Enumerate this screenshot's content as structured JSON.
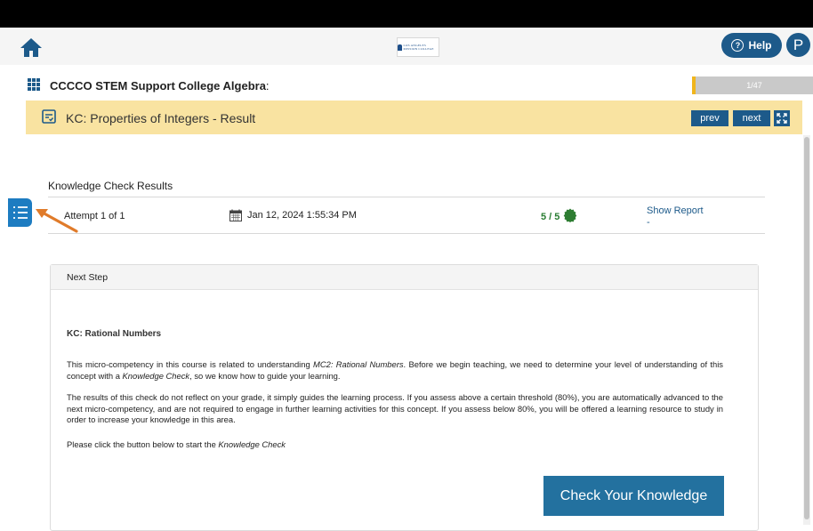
{
  "header": {
    "logo_text": "LOS ANGELES MISSION COLLEGE",
    "help_label": "Help",
    "avatar_initial": "P"
  },
  "course": {
    "title": "CCCCO STEM Support College Algebra",
    "title_suffix": ":",
    "progress_label": "1/47"
  },
  "kc_bar": {
    "title": "KC: Properties of Integers - Result",
    "prev_label": "prev",
    "next_label": "next"
  },
  "results": {
    "heading": "Knowledge Check Results",
    "attempt": "Attempt 1 of 1",
    "date": "Jan 12, 2024 1:55:34 PM",
    "score": "5 / 5",
    "show_report": "Show Report",
    "show_report_sub": "-"
  },
  "next_step": {
    "heading": "Next Step",
    "title": "KC: Rational Numbers",
    "p1_a": "This micro-competency in this course is related to understanding ",
    "p1_em": "MC2: Rational Numbers",
    "p1_b": ". Before we begin teaching, we need to determine your level of understanding of this concept with a ",
    "p1_em2": "Knowledge Check",
    "p1_c": ", so we know how to guide your learning.",
    "p2": "The results of this check do not reflect on your grade, it simply guides the learning process. If you assess above a certain threshold (80%), you are automatically advanced to the next micro-competency, and are not required to engage in further learning activities for this concept. If you assess below 80%, you will be offered a learning resource to study in order to increase your knowledge in this area.",
    "p3_a": "Please click the button below to start the ",
    "p3_em": "Knowledge Check",
    "button_label": "Check Your Knowledge"
  },
  "colors": {
    "brand_blue": "#1d5a8a",
    "kc_bar_bg": "#f9e3a1",
    "progress_accent": "#f0b51d",
    "score_green": "#2a7d33",
    "annotation_arrow": "#e07b2a"
  },
  "icons": {
    "home": "home-icon",
    "grid": "grid-menu-icon",
    "kc": "checklist-icon",
    "expand": "expand-icon",
    "calendar": "calendar-icon",
    "badge": "badge-icon",
    "sidebar": "list-toggle-icon",
    "arrow": "annotation-arrow-icon"
  }
}
